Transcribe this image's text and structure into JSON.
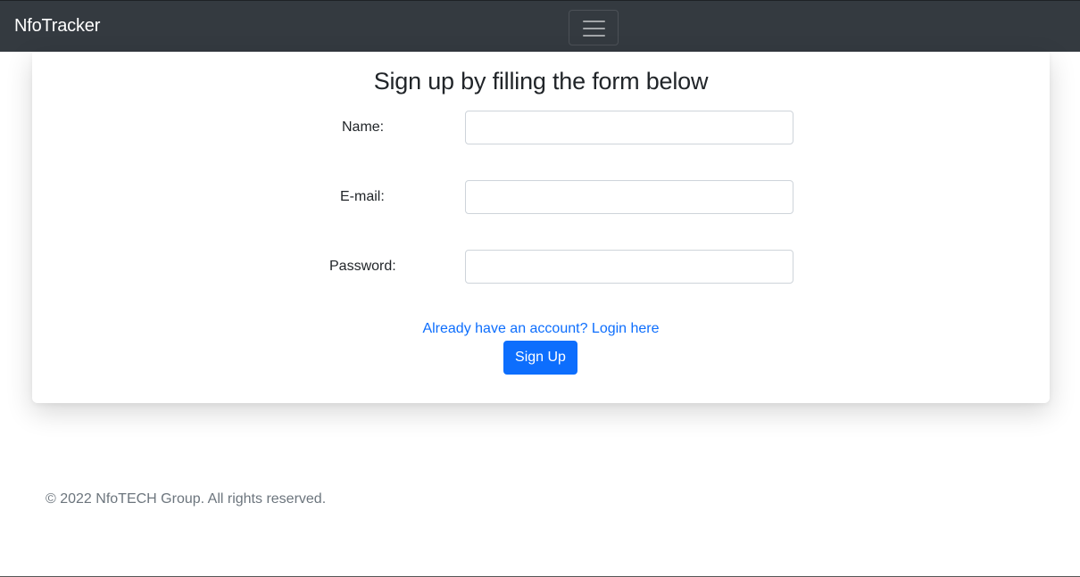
{
  "navbar": {
    "brand": "NfoTracker",
    "toggler_icon": "hamburger-menu-icon",
    "background": "#343a40"
  },
  "form": {
    "title": "Sign up by filling the form below",
    "fields": [
      {
        "label": "Name:",
        "value": "",
        "type": "text"
      },
      {
        "label": "E-mail:",
        "value": "",
        "type": "email"
      },
      {
        "label": "Password:",
        "value": "",
        "type": "password"
      }
    ],
    "login_link": "Already have an account? Login here",
    "submit_label": "Sign Up",
    "accent": "#0d6efd"
  },
  "footer": {
    "text": "© 2022 NfoTECH Group. All rights reserved."
  }
}
